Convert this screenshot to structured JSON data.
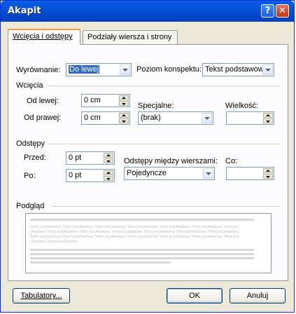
{
  "window": {
    "title": "Akapit",
    "help_glyph": "?",
    "close_glyph": "✕"
  },
  "tabs": [
    {
      "label": "Wcięcia i odstępy",
      "active": true
    },
    {
      "label": "Podziały wiersza i strony",
      "active": false
    }
  ],
  "general": {
    "alignment_label": "Wyrównanie:",
    "alignment_value": "Do lewej",
    "outline_label": "Poziom konspektu:",
    "outline_value": "Tekst podstawowy"
  },
  "indent": {
    "section_label": "Wcięcia",
    "left_label": "Od lewej:",
    "left_value": "0 cm",
    "right_label": "Od prawej:",
    "right_value": "0 cm",
    "special_label": "Specjalne:",
    "special_value": "(brak)",
    "size_label": "Wielkość:",
    "size_value": ""
  },
  "spacing": {
    "section_label": "Odstępy",
    "before_label": "Przed:",
    "before_value": "0 pt",
    "after_label": "Po:",
    "after_value": "0 pt",
    "line_label": "Odstępy między wierszami:",
    "line_value": "Pojedyncze",
    "at_label": "Co:",
    "at_value": ""
  },
  "preview": {
    "section_label": "Podgląd",
    "sample_text": "Tekst przykładowy Tekst przykładowy Tekst przykładowy Tekst przykładowy Tekst przykładowy Tekst przykładowy Tekst przykładowy Tekst przykładowy Tekst przykładowy Tekst przykładowy Tekst przykładowy Tekst przykładowy Tekst przykładowy Tekst przykładowy Tekst przykładowy Tekst przykładowy Tekst przykładowy Tekst przykładowy Tekst przykładowy Tekst przykładowy Tekst przykładowy"
  },
  "buttons": {
    "tabs": "Tabulatory...",
    "ok": "OK",
    "cancel": "Anuluj"
  },
  "colors": {
    "title_bar": "#0553d7",
    "selection": "#316ac5",
    "tab_highlight": "#ff9933"
  }
}
